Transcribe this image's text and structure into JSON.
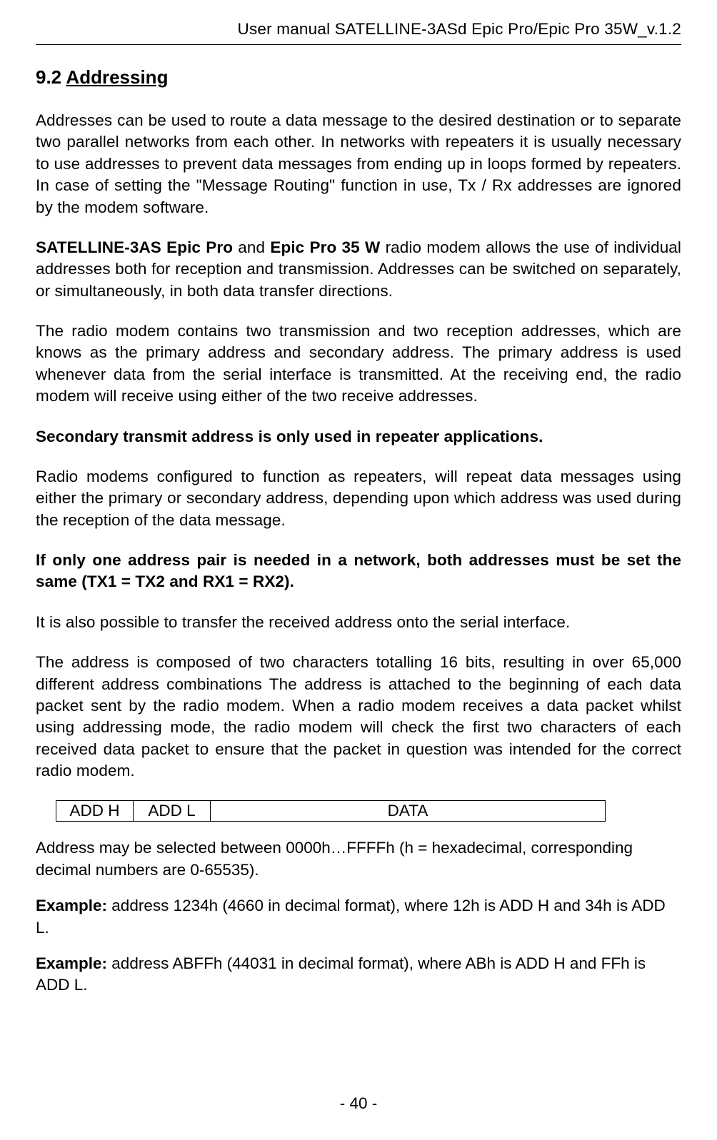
{
  "header": {
    "text": "User manual SATELLINE-3ASd Epic Pro/Epic Pro 35W_v.1.2"
  },
  "section": {
    "number": "9.2",
    "title": "Addressing"
  },
  "paragraphs": {
    "p1": "Addresses can be used to route a data message to the desired destination or to separate two parallel networks from each other. In networks with repeaters it is usually necessary to use addresses to prevent data messages from ending up in loops formed by repeaters. In case of setting the \"Message Routing\" function in use, Tx / Rx addresses are ignored by the modem software.",
    "p2_a": "SATELLINE-3AS Epic Pro",
    "p2_b": " and ",
    "p2_c": "Epic Pro 35 W",
    "p2_d": " radio modem allows the use of individual addresses both for reception and transmission. Addresses can be switched on separately, or simultaneously, in both data transfer directions.",
    "p3": "The radio modem contains two transmission and two reception addresses, which are knows as the primary address and secondary address. The primary address is used whenever data from the serial interface is transmitted. At the receiving end, the radio modem will receive using either of the two receive addresses.",
    "p4": "Secondary transmit address is only used in repeater applications.",
    "p5": "Radio modems configured to function as repeaters, will repeat data messages using either the primary or secondary address, depending upon which address was used during the reception of the data message.",
    "p6": "If only one address pair is needed in a network, both addresses must be set the same (TX1 = TX2 and RX1 = RX2).",
    "p7": "It is also possible to transfer the received address onto the serial interface.",
    "p8": "The address is composed of two characters totalling 16 bits, resulting in over 65,000 different address combinations The address is attached to the beginning of each data packet sent by the radio modem. When a radio modem receives a data packet whilst using addressing mode, the radio modem will check the first two characters of each received data packet to ensure that the packet in question was intended for the correct radio modem.",
    "p9": "Address may be selected between 0000h…FFFFh (h = hexadecimal, corresponding decimal numbers are 0-65535).",
    "p10_label": "Example:",
    "p10_text": " address 1234h (4660 in decimal format), where 12h is ADD H and 34h is ADD L.",
    "p11_label": "Example:",
    "p11_text": " address ABFFh (44031 in decimal format), where ABh is ADD H and FFh is ADD L."
  },
  "table": {
    "cells": [
      "ADD H",
      "ADD L",
      "DATA"
    ]
  },
  "footer": {
    "page": "- 40 -"
  }
}
